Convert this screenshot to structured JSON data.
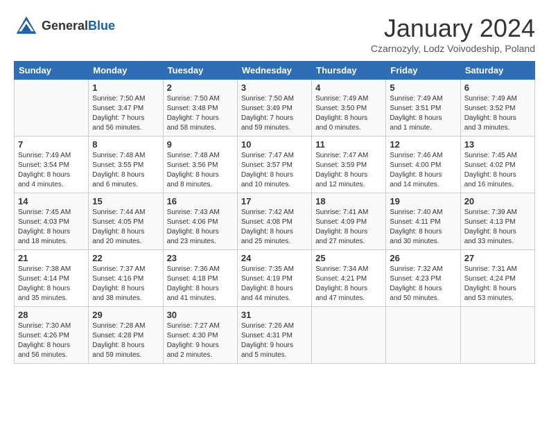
{
  "header": {
    "logo_general": "General",
    "logo_blue": "Blue",
    "month_title": "January 2024",
    "subtitle": "Czarnozyly, Lodz Voivodeship, Poland"
  },
  "days_of_week": [
    "Sunday",
    "Monday",
    "Tuesday",
    "Wednesday",
    "Thursday",
    "Friday",
    "Saturday"
  ],
  "weeks": [
    [
      {
        "day": "",
        "info": ""
      },
      {
        "day": "1",
        "info": "Sunrise: 7:50 AM\nSunset: 3:47 PM\nDaylight: 7 hours\nand 56 minutes."
      },
      {
        "day": "2",
        "info": "Sunrise: 7:50 AM\nSunset: 3:48 PM\nDaylight: 7 hours\nand 58 minutes."
      },
      {
        "day": "3",
        "info": "Sunrise: 7:50 AM\nSunset: 3:49 PM\nDaylight: 7 hours\nand 59 minutes."
      },
      {
        "day": "4",
        "info": "Sunrise: 7:49 AM\nSunset: 3:50 PM\nDaylight: 8 hours\nand 0 minutes."
      },
      {
        "day": "5",
        "info": "Sunrise: 7:49 AM\nSunset: 3:51 PM\nDaylight: 8 hours\nand 1 minute."
      },
      {
        "day": "6",
        "info": "Sunrise: 7:49 AM\nSunset: 3:52 PM\nDaylight: 8 hours\nand 3 minutes."
      }
    ],
    [
      {
        "day": "7",
        "info": "Sunrise: 7:49 AM\nSunset: 3:54 PM\nDaylight: 8 hours\nand 4 minutes."
      },
      {
        "day": "8",
        "info": "Sunrise: 7:48 AM\nSunset: 3:55 PM\nDaylight: 8 hours\nand 6 minutes."
      },
      {
        "day": "9",
        "info": "Sunrise: 7:48 AM\nSunset: 3:56 PM\nDaylight: 8 hours\nand 8 minutes."
      },
      {
        "day": "10",
        "info": "Sunrise: 7:47 AM\nSunset: 3:57 PM\nDaylight: 8 hours\nand 10 minutes."
      },
      {
        "day": "11",
        "info": "Sunrise: 7:47 AM\nSunset: 3:59 PM\nDaylight: 8 hours\nand 12 minutes."
      },
      {
        "day": "12",
        "info": "Sunrise: 7:46 AM\nSunset: 4:00 PM\nDaylight: 8 hours\nand 14 minutes."
      },
      {
        "day": "13",
        "info": "Sunrise: 7:45 AM\nSunset: 4:02 PM\nDaylight: 8 hours\nand 16 minutes."
      }
    ],
    [
      {
        "day": "14",
        "info": "Sunrise: 7:45 AM\nSunset: 4:03 PM\nDaylight: 8 hours\nand 18 minutes."
      },
      {
        "day": "15",
        "info": "Sunrise: 7:44 AM\nSunset: 4:05 PM\nDaylight: 8 hours\nand 20 minutes."
      },
      {
        "day": "16",
        "info": "Sunrise: 7:43 AM\nSunset: 4:06 PM\nDaylight: 8 hours\nand 23 minutes."
      },
      {
        "day": "17",
        "info": "Sunrise: 7:42 AM\nSunset: 4:08 PM\nDaylight: 8 hours\nand 25 minutes."
      },
      {
        "day": "18",
        "info": "Sunrise: 7:41 AM\nSunset: 4:09 PM\nDaylight: 8 hours\nand 27 minutes."
      },
      {
        "day": "19",
        "info": "Sunrise: 7:40 AM\nSunset: 4:11 PM\nDaylight: 8 hours\nand 30 minutes."
      },
      {
        "day": "20",
        "info": "Sunrise: 7:39 AM\nSunset: 4:13 PM\nDaylight: 8 hours\nand 33 minutes."
      }
    ],
    [
      {
        "day": "21",
        "info": "Sunrise: 7:38 AM\nSunset: 4:14 PM\nDaylight: 8 hours\nand 35 minutes."
      },
      {
        "day": "22",
        "info": "Sunrise: 7:37 AM\nSunset: 4:16 PM\nDaylight: 8 hours\nand 38 minutes."
      },
      {
        "day": "23",
        "info": "Sunrise: 7:36 AM\nSunset: 4:18 PM\nDaylight: 8 hours\nand 41 minutes."
      },
      {
        "day": "24",
        "info": "Sunrise: 7:35 AM\nSunset: 4:19 PM\nDaylight: 8 hours\nand 44 minutes."
      },
      {
        "day": "25",
        "info": "Sunrise: 7:34 AM\nSunset: 4:21 PM\nDaylight: 8 hours\nand 47 minutes."
      },
      {
        "day": "26",
        "info": "Sunrise: 7:32 AM\nSunset: 4:23 PM\nDaylight: 8 hours\nand 50 minutes."
      },
      {
        "day": "27",
        "info": "Sunrise: 7:31 AM\nSunset: 4:24 PM\nDaylight: 8 hours\nand 53 minutes."
      }
    ],
    [
      {
        "day": "28",
        "info": "Sunrise: 7:30 AM\nSunset: 4:26 PM\nDaylight: 8 hours\nand 56 minutes."
      },
      {
        "day": "29",
        "info": "Sunrise: 7:28 AM\nSunset: 4:28 PM\nDaylight: 8 hours\nand 59 minutes."
      },
      {
        "day": "30",
        "info": "Sunrise: 7:27 AM\nSunset: 4:30 PM\nDaylight: 9 hours\nand 2 minutes."
      },
      {
        "day": "31",
        "info": "Sunrise: 7:26 AM\nSunset: 4:31 PM\nDaylight: 9 hours\nand 5 minutes."
      },
      {
        "day": "",
        "info": ""
      },
      {
        "day": "",
        "info": ""
      },
      {
        "day": "",
        "info": ""
      }
    ]
  ]
}
